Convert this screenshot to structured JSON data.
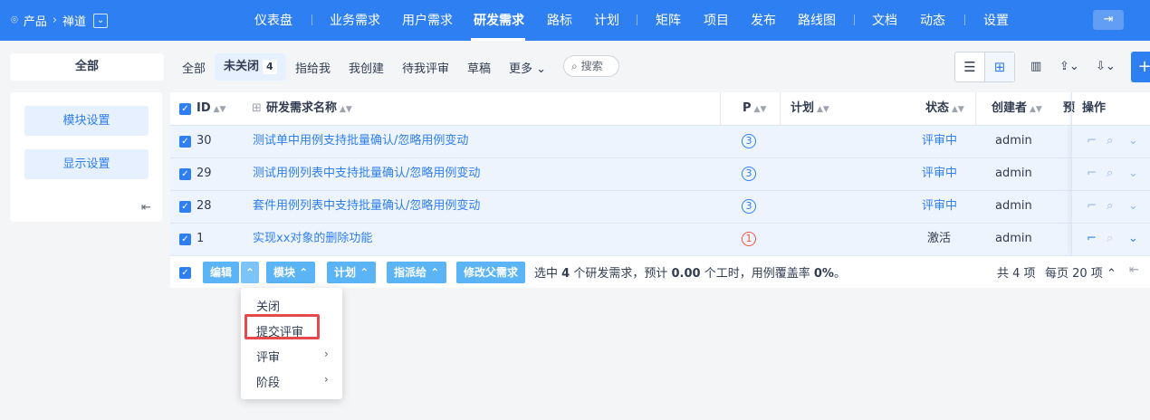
{
  "topnav": {
    "product_label": "产品",
    "product_name": "禅道",
    "items": [
      "仪表盘",
      "业务需求",
      "用户需求",
      "研发需求",
      "路标",
      "计划",
      "矩阵",
      "项目",
      "发布",
      "路线图",
      "文档",
      "动态",
      "设置"
    ],
    "active": "研发需求",
    "brand_color": "#2e7ff1"
  },
  "filterbar": {
    "all_label": "全部",
    "tabs": [
      {
        "label": "全部"
      },
      {
        "label": "未关闭",
        "count": "4"
      },
      {
        "label": "指给我"
      },
      {
        "label": "我创建"
      },
      {
        "label": "待我评审"
      },
      {
        "label": "草稿"
      },
      {
        "label": "更多"
      }
    ],
    "search_placeholder": "搜索"
  },
  "sidebar": {
    "module_settings": "模块设置",
    "display_settings": "显示设置"
  },
  "table": {
    "headers": {
      "id": "ID",
      "name": "研发需求名称",
      "pri": "P",
      "plan": "计划",
      "status": "状态",
      "creator": "创建者",
      "estimate": "预",
      "actions": "操作"
    },
    "rows": [
      {
        "id": "30",
        "name": "测试单中用例支持批量确认/忽略用例变动",
        "pri": "3",
        "plan": "",
        "status": "评审中",
        "creator": "admin"
      },
      {
        "id": "29",
        "name": "测试用例列表中支持批量确认/忽略用例变动",
        "pri": "3",
        "plan": "",
        "status": "评审中",
        "creator": "admin"
      },
      {
        "id": "28",
        "name": "套件用例列表中支持批量确认/忽略用例变动",
        "pri": "3",
        "plan": "",
        "status": "评审中",
        "creator": "admin"
      },
      {
        "id": "1",
        "name": "实现xx对象的删除功能",
        "pri": "1",
        "plan": "",
        "status": "激活",
        "creator": "admin"
      }
    ]
  },
  "footer": {
    "buttons": {
      "edit": "编辑",
      "module": "模块",
      "plan": "计划",
      "assign": "指派给",
      "parent": "修改父需求"
    },
    "summary": {
      "prefix": "选中",
      "selected": "4",
      "mid1": "个研发需求，预计",
      "hours": "0.00",
      "mid2": "个工时，用例覆盖率",
      "coverage": "0%",
      "suffix": "。"
    },
    "total": "共 4 项",
    "per_page": "每页 20 项"
  },
  "dropdown": {
    "items": [
      "关闭",
      "提交评审",
      "评审",
      "阶段"
    ],
    "highlight_color": "#e5484d"
  }
}
